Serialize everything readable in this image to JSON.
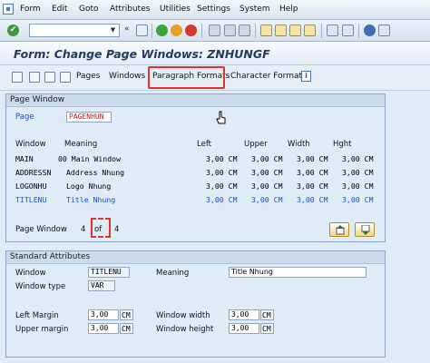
{
  "menubar": {
    "items": [
      "Form",
      "Edit",
      "Goto",
      "Attributes",
      "Utilities",
      "Settings",
      "System",
      "Help"
    ]
  },
  "toolbar": {
    "command_field": ""
  },
  "title": "Form: Change Page Windows: ZNHUNGF",
  "app_toolbar": {
    "pages": "Pages",
    "windows": "Windows",
    "paragraph_formats": "Paragraph Formats",
    "character_formats": "Character Formats"
  },
  "page_window": {
    "group_title": "Page Window",
    "page_label": "Page",
    "page_value": "PAGENHUN",
    "headers": {
      "window": "Window",
      "meaning": "Meaning",
      "left": "Left",
      "upper": "Upper",
      "width": "Width",
      "height": "Hght"
    },
    "rows": [
      {
        "window": "MAIN",
        "meaning": "00 Main Window",
        "left": "3,00 CM",
        "upper": "3,00 CM",
        "width": "3,00 CM",
        "height": "3,00 CM",
        "selected": false
      },
      {
        "window": "ADDRESSN",
        "meaning": "Address Nhung",
        "left": "3,00 CM",
        "upper": "3,00 CM",
        "width": "3,00 CM",
        "height": "3,00 CM",
        "selected": false
      },
      {
        "window": "LOGONHU",
        "meaning": "Logo Nhung",
        "left": "3,00 CM",
        "upper": "3,00 CM",
        "width": "3,00 CM",
        "height": "3,00 CM",
        "selected": false
      },
      {
        "window": "TITLENU",
        "meaning": "Title Nhung",
        "left": "3,00 CM",
        "upper": "3,00 CM",
        "width": "3,00 CM",
        "height": "3,00 CM",
        "selected": true
      }
    ],
    "pager_label": "Page Window",
    "pager_current": "4",
    "pager_of": "of",
    "pager_total": "4"
  },
  "standard_attributes": {
    "group_title": "Standard Attributes",
    "window_label": "Window",
    "window_value": "TITLENU",
    "meaning_label": "Meaning",
    "meaning_value": "Title Nhung",
    "window_type_label": "Window type",
    "window_type_value": "VAR",
    "left_margin_label": "Left Margin",
    "left_margin_value": "3,00",
    "left_margin_unit": "CM",
    "upper_margin_label": "Upper margin",
    "upper_margin_value": "3,00",
    "upper_margin_unit": "CM",
    "window_width_label": "Window width",
    "window_width_value": "3,00",
    "window_width_unit": "CM",
    "window_height_label": "Window height",
    "window_height_value": "3,00",
    "window_height_unit": "CM"
  },
  "colors": {
    "title": "#213c5c",
    "selected_row": "#1f4fd0",
    "highlight_box": "#e0322f",
    "page_value": "#c02020"
  }
}
